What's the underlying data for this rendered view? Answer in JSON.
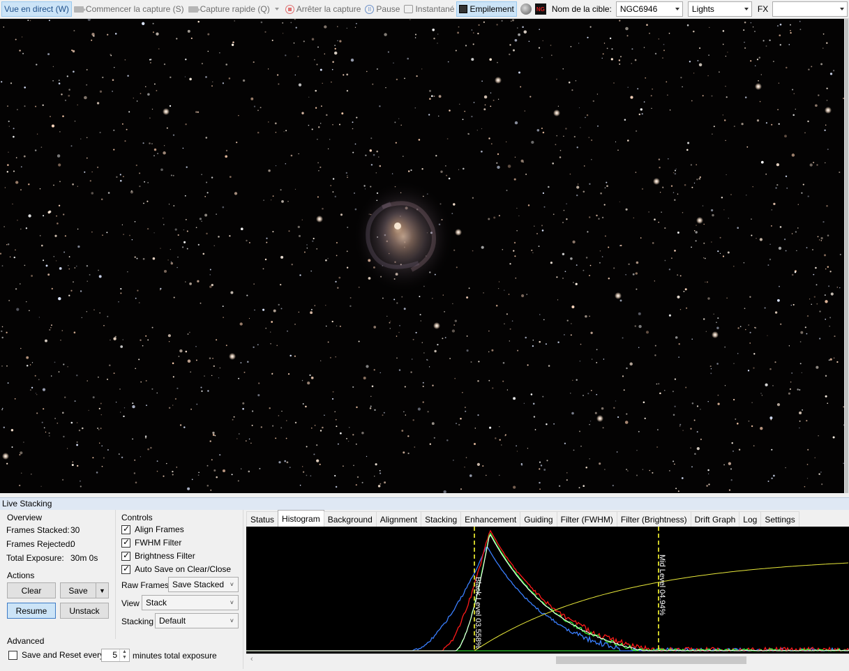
{
  "toolbar": {
    "live_view": "Vue en direct (W)",
    "start_capture": "Commencer la capture (S)",
    "quick_capture": "Capture rapide (Q)",
    "stop_capture": "Arrêter la capture",
    "pause": "Pause",
    "snapshot": "Instantané",
    "stacking": "Empilement",
    "ngc_icon_text": "NG",
    "target_label": "Nom de la cible:",
    "target_value": "NGC6946",
    "frame_type_value": "Lights",
    "fx_label": "FX",
    "fx_value": ""
  },
  "panel": {
    "title": "Live Stacking",
    "overview": {
      "title": "Overview",
      "frames_stacked_label": "Frames Stacked:",
      "frames_stacked_value": "30",
      "frames_rejected_label": "Frames Rejected:",
      "frames_rejected_value": "0",
      "total_exposure_label": "Total Exposure:",
      "total_exposure_value": "30m 0s"
    },
    "actions": {
      "title": "Actions",
      "clear": "Clear",
      "save": "Save",
      "resume": "Resume",
      "unstack": "Unstack"
    },
    "advanced": {
      "title": "Advanced",
      "save_reset_label": "Save and Reset every",
      "save_reset_checked": false,
      "minutes_value": "5",
      "minutes_suffix": "minutes total exposure"
    },
    "controls": {
      "title": "Controls",
      "align_frames": "Align Frames",
      "fwhm_filter": "FWHM Filter",
      "brightness_filter": "Brightness Filter",
      "auto_save": "Auto Save on Clear/Close",
      "raw_frames_label": "Raw Frames",
      "raw_frames_value": "Save Stacked",
      "view_label": "View",
      "view_value": "Stack",
      "stacking_label": "Stacking",
      "stacking_value": "Default"
    },
    "tabs": [
      "Status",
      "Histogram",
      "Background",
      "Alignment",
      "Stacking",
      "Enhancement",
      "Guiding",
      "Filter (FWHM)",
      "Filter (Brightness)",
      "Drift Graph",
      "Log",
      "Settings"
    ],
    "active_tab": "Histogram",
    "histogram": {
      "black_level_label": "Black Level  03.558%",
      "mid_level_label": "Mid Level  04.94%",
      "colors": {
        "red": "#ff1a1a",
        "green": "#3dff3d",
        "blue": "#3a7fff",
        "white": "#ffffff",
        "curve": "#e8e83a",
        "marker": "#ffff33"
      }
    }
  }
}
